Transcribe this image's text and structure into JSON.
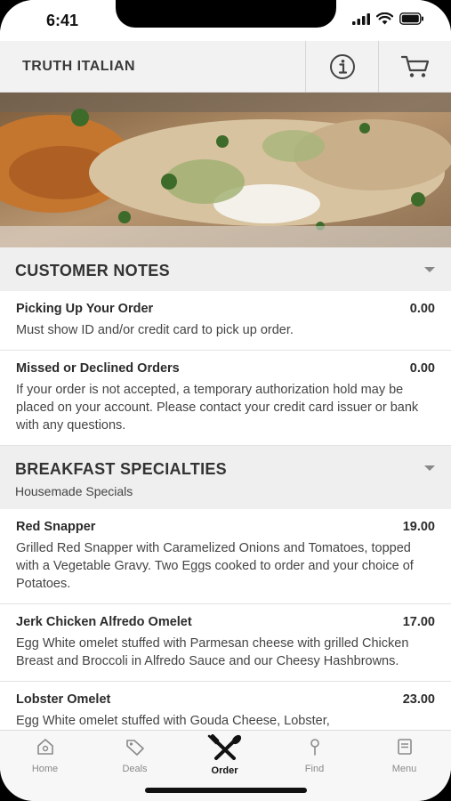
{
  "status": {
    "time": "6:41"
  },
  "header": {
    "brand": "TRUTH ITALIAN",
    "info_icon": "info-icon",
    "cart_icon": "cart-icon"
  },
  "sections": {
    "customer_notes": {
      "title": "CUSTOMER NOTES",
      "items": [
        {
          "name": "Picking Up Your Order",
          "price": "0.00",
          "desc": "Must show ID and/or credit card to pick up order."
        },
        {
          "name": "Missed or Declined Orders",
          "price": "0.00",
          "desc": "If your order is not accepted, a temporary authorization hold may be placed on your account. Please contact your credit card issuer or bank with any questions."
        }
      ]
    },
    "breakfast": {
      "title": "BREAKFAST SPECIALTIES",
      "subtitle": "Housemade Specials",
      "items": [
        {
          "name": "Red Snapper",
          "price": "19.00",
          "desc": "Grilled Red Snapper with Caramelized Onions and Tomatoes, topped with a Vegetable Gravy. Two Eggs cooked to order and your choice of Potatoes."
        },
        {
          "name": "Jerk Chicken Alfredo Omelet",
          "price": "17.00",
          "desc": "Egg White omelet stuffed with Parmesan cheese with grilled Chicken Breast and Broccoli in Alfredo Sauce and our Cheesy Hashbrowns."
        },
        {
          "name": "Lobster Omelet",
          "price": "23.00",
          "desc": "Egg White omelet stuffed with Gouda Cheese, Lobster,"
        }
      ]
    }
  },
  "tabs": [
    {
      "label": "Home",
      "icon": "home-icon"
    },
    {
      "label": "Deals",
      "icon": "tag-icon"
    },
    {
      "label": "Order",
      "icon": "utensils-icon"
    },
    {
      "label": "Find",
      "icon": "pin-icon"
    },
    {
      "label": "Menu",
      "icon": "book-icon"
    }
  ],
  "colors": {
    "accent": "#111111",
    "header_bg": "#f2f2f2",
    "section_bg": "#efefef",
    "tab_inactive": "#8a8a8a"
  }
}
